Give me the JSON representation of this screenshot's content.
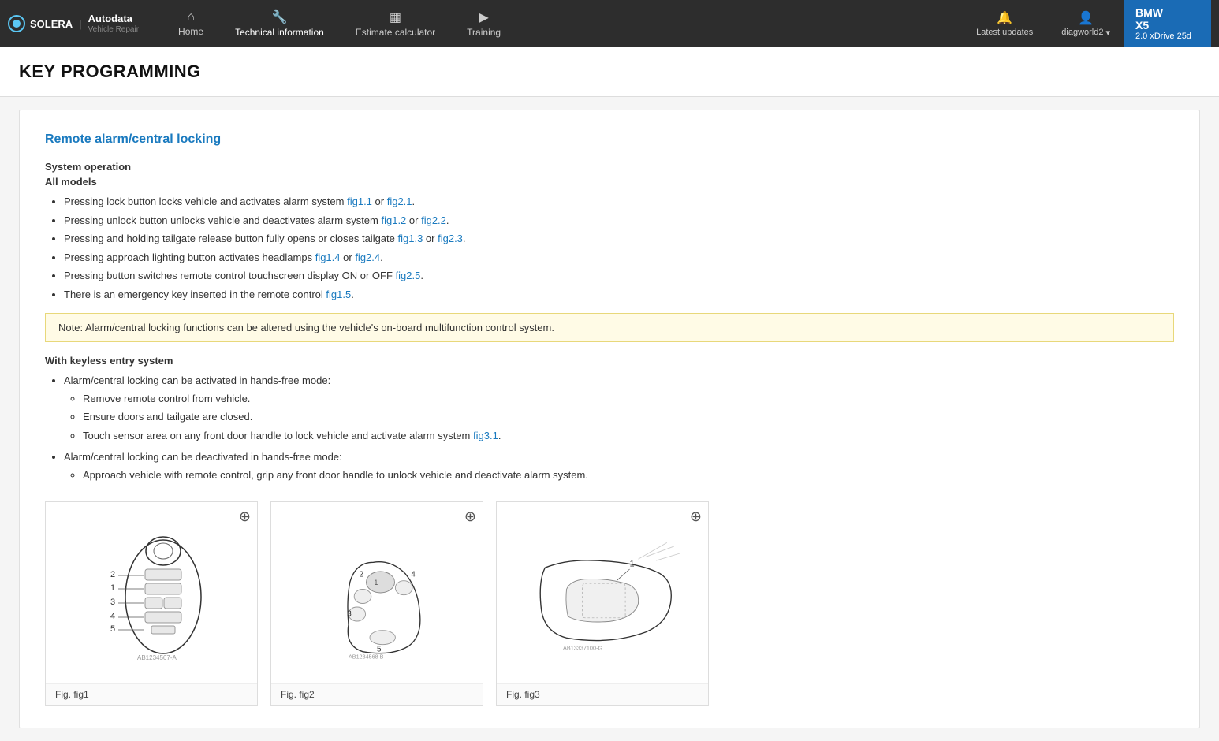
{
  "brand": {
    "name": "SOLERA",
    "separator": "|",
    "product": "Autodata",
    "tagline": "Vehicle Repair"
  },
  "navbar": {
    "items": [
      {
        "id": "home",
        "label": "Home",
        "icon": "🏠"
      },
      {
        "id": "technical-information",
        "label": "Technical information",
        "icon": "🔧"
      },
      {
        "id": "estimate-calculator",
        "label": "Estimate calculator",
        "icon": "📊"
      },
      {
        "id": "training",
        "label": "Training",
        "icon": "▶"
      }
    ],
    "right": [
      {
        "id": "latest-updates",
        "label": "Latest updates",
        "icon": "🔔"
      },
      {
        "id": "user",
        "label": "diagworld2",
        "icon": "👤"
      }
    ]
  },
  "vehicle": {
    "brand": "BMW",
    "model": "X5",
    "engine": "2.0 xDrive 25d"
  },
  "page": {
    "title": "KEY PROGRAMMING"
  },
  "content": {
    "section_title": "Remote alarm/central locking",
    "system_operation": {
      "heading": "System operation",
      "subheading": "All models",
      "bullets": [
        {
          "text": "Pressing lock button locks vehicle and activates alarm system ",
          "links": [
            {
              "label": "fig1.1",
              "href": "#"
            },
            {
              "sep": " or "
            },
            {
              "label": "fig2.1",
              "href": "#"
            }
          ],
          "end": "."
        },
        {
          "text": "Pressing unlock button unlocks vehicle and deactivates alarm system ",
          "links": [
            {
              "label": "fig1.2",
              "href": "#"
            },
            {
              "sep": " or "
            },
            {
              "label": "fig2.2",
              "href": "#"
            }
          ],
          "end": "."
        },
        {
          "text": "Pressing and holding tailgate release button fully opens or closes tailgate ",
          "links": [
            {
              "label": "fig1.3",
              "href": "#"
            },
            {
              "sep": " or "
            },
            {
              "label": "fig2.3",
              "href": "#"
            }
          ],
          "end": "."
        },
        {
          "text": "Pressing approach lighting button activates headlamps ",
          "links": [
            {
              "label": "fig1.4",
              "href": "#"
            },
            {
              "sep": " or "
            },
            {
              "label": "fig2.4",
              "href": "#"
            }
          ],
          "end": "."
        },
        {
          "text": "Pressing button switches remote control touchscreen display ON or OFF ",
          "links": [
            {
              "label": "fig2.5",
              "href": "#"
            }
          ],
          "end": "."
        },
        {
          "text": "There is an emergency key inserted in the remote control ",
          "links": [
            {
              "label": "fig1.5",
              "href": "#"
            }
          ],
          "end": "."
        }
      ]
    },
    "note": "Note: Alarm/central locking functions can be altered using the vehicle's on-board multifunction control system.",
    "keyless": {
      "heading": "With keyless entry system",
      "bullets": [
        {
          "text": "Alarm/central locking can be activated in hands-free mode:",
          "sub": [
            {
              "text": "Remove remote control from vehicle."
            },
            {
              "text": "Ensure doors and tailgate are closed."
            },
            {
              "text": "Touch sensor area on any front door handle to lock vehicle and activate alarm system ",
              "links": [
                {
                  "label": "fig3.1",
                  "href": "#"
                }
              ],
              "end": "."
            }
          ]
        },
        {
          "text": "Alarm/central locking can be deactivated in hands-free mode:",
          "sub": [
            {
              "text": "Approach vehicle with remote control, grip any front door handle to unlock vehicle and deactivate alarm system."
            }
          ]
        }
      ]
    },
    "figures": [
      {
        "id": "fig1",
        "label": "Fig. fig1"
      },
      {
        "id": "fig2",
        "label": "Fig. fig2"
      },
      {
        "id": "fig3",
        "label": "Fig. fig3"
      }
    ]
  }
}
